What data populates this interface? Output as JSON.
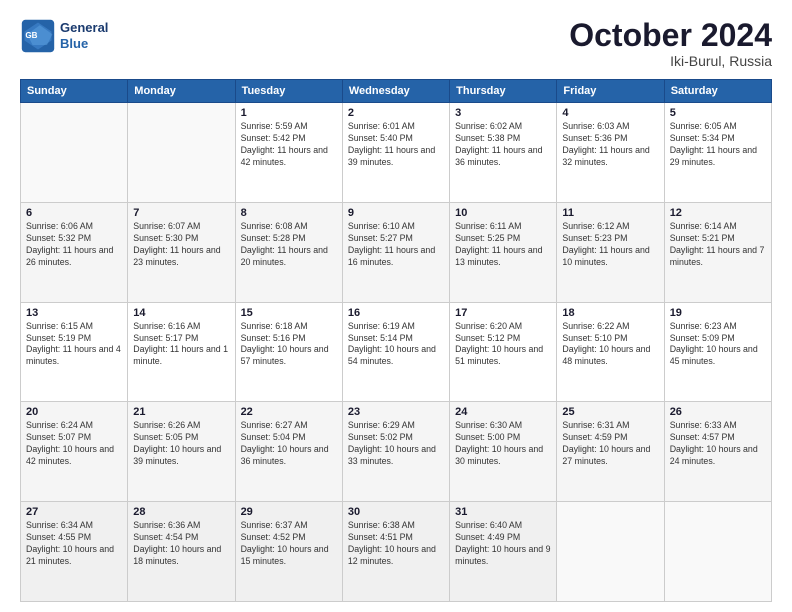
{
  "header": {
    "logo_line1": "General",
    "logo_line2": "Blue",
    "month": "October 2024",
    "location": "Iki-Burul, Russia"
  },
  "weekdays": [
    "Sunday",
    "Monday",
    "Tuesday",
    "Wednesday",
    "Thursday",
    "Friday",
    "Saturday"
  ],
  "weeks": [
    [
      {
        "day": "",
        "info": ""
      },
      {
        "day": "",
        "info": ""
      },
      {
        "day": "1",
        "info": "Sunrise: 5:59 AM\nSunset: 5:42 PM\nDaylight: 11 hours and 42 minutes."
      },
      {
        "day": "2",
        "info": "Sunrise: 6:01 AM\nSunset: 5:40 PM\nDaylight: 11 hours and 39 minutes."
      },
      {
        "day": "3",
        "info": "Sunrise: 6:02 AM\nSunset: 5:38 PM\nDaylight: 11 hours and 36 minutes."
      },
      {
        "day": "4",
        "info": "Sunrise: 6:03 AM\nSunset: 5:36 PM\nDaylight: 11 hours and 32 minutes."
      },
      {
        "day": "5",
        "info": "Sunrise: 6:05 AM\nSunset: 5:34 PM\nDaylight: 11 hours and 29 minutes."
      }
    ],
    [
      {
        "day": "6",
        "info": "Sunrise: 6:06 AM\nSunset: 5:32 PM\nDaylight: 11 hours and 26 minutes."
      },
      {
        "day": "7",
        "info": "Sunrise: 6:07 AM\nSunset: 5:30 PM\nDaylight: 11 hours and 23 minutes."
      },
      {
        "day": "8",
        "info": "Sunrise: 6:08 AM\nSunset: 5:28 PM\nDaylight: 11 hours and 20 minutes."
      },
      {
        "day": "9",
        "info": "Sunrise: 6:10 AM\nSunset: 5:27 PM\nDaylight: 11 hours and 16 minutes."
      },
      {
        "day": "10",
        "info": "Sunrise: 6:11 AM\nSunset: 5:25 PM\nDaylight: 11 hours and 13 minutes."
      },
      {
        "day": "11",
        "info": "Sunrise: 6:12 AM\nSunset: 5:23 PM\nDaylight: 11 hours and 10 minutes."
      },
      {
        "day": "12",
        "info": "Sunrise: 6:14 AM\nSunset: 5:21 PM\nDaylight: 11 hours and 7 minutes."
      }
    ],
    [
      {
        "day": "13",
        "info": "Sunrise: 6:15 AM\nSunset: 5:19 PM\nDaylight: 11 hours and 4 minutes."
      },
      {
        "day": "14",
        "info": "Sunrise: 6:16 AM\nSunset: 5:17 PM\nDaylight: 11 hours and 1 minute."
      },
      {
        "day": "15",
        "info": "Sunrise: 6:18 AM\nSunset: 5:16 PM\nDaylight: 10 hours and 57 minutes."
      },
      {
        "day": "16",
        "info": "Sunrise: 6:19 AM\nSunset: 5:14 PM\nDaylight: 10 hours and 54 minutes."
      },
      {
        "day": "17",
        "info": "Sunrise: 6:20 AM\nSunset: 5:12 PM\nDaylight: 10 hours and 51 minutes."
      },
      {
        "day": "18",
        "info": "Sunrise: 6:22 AM\nSunset: 5:10 PM\nDaylight: 10 hours and 48 minutes."
      },
      {
        "day": "19",
        "info": "Sunrise: 6:23 AM\nSunset: 5:09 PM\nDaylight: 10 hours and 45 minutes."
      }
    ],
    [
      {
        "day": "20",
        "info": "Sunrise: 6:24 AM\nSunset: 5:07 PM\nDaylight: 10 hours and 42 minutes."
      },
      {
        "day": "21",
        "info": "Sunrise: 6:26 AM\nSunset: 5:05 PM\nDaylight: 10 hours and 39 minutes."
      },
      {
        "day": "22",
        "info": "Sunrise: 6:27 AM\nSunset: 5:04 PM\nDaylight: 10 hours and 36 minutes."
      },
      {
        "day": "23",
        "info": "Sunrise: 6:29 AM\nSunset: 5:02 PM\nDaylight: 10 hours and 33 minutes."
      },
      {
        "day": "24",
        "info": "Sunrise: 6:30 AM\nSunset: 5:00 PM\nDaylight: 10 hours and 30 minutes."
      },
      {
        "day": "25",
        "info": "Sunrise: 6:31 AM\nSunset: 4:59 PM\nDaylight: 10 hours and 27 minutes."
      },
      {
        "day": "26",
        "info": "Sunrise: 6:33 AM\nSunset: 4:57 PM\nDaylight: 10 hours and 24 minutes."
      }
    ],
    [
      {
        "day": "27",
        "info": "Sunrise: 6:34 AM\nSunset: 4:55 PM\nDaylight: 10 hours and 21 minutes."
      },
      {
        "day": "28",
        "info": "Sunrise: 6:36 AM\nSunset: 4:54 PM\nDaylight: 10 hours and 18 minutes."
      },
      {
        "day": "29",
        "info": "Sunrise: 6:37 AM\nSunset: 4:52 PM\nDaylight: 10 hours and 15 minutes."
      },
      {
        "day": "30",
        "info": "Sunrise: 6:38 AM\nSunset: 4:51 PM\nDaylight: 10 hours and 12 minutes."
      },
      {
        "day": "31",
        "info": "Sunrise: 6:40 AM\nSunset: 4:49 PM\nDaylight: 10 hours and 9 minutes."
      },
      {
        "day": "",
        "info": ""
      },
      {
        "day": "",
        "info": ""
      }
    ]
  ]
}
